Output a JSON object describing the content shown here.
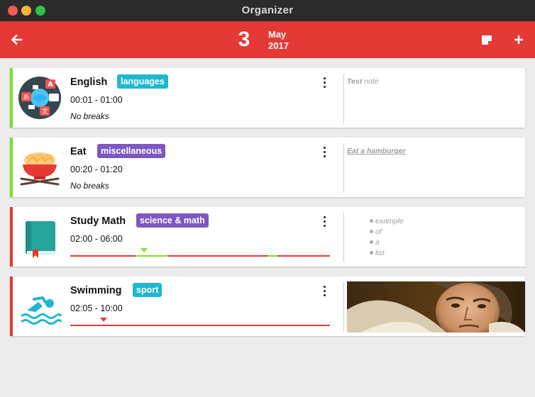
{
  "window": {
    "title": "Organizer"
  },
  "header": {
    "day": "3",
    "month": "May",
    "year": "2017",
    "back_icon": "arrow-left-icon",
    "note_icon": "note-icon",
    "add_icon": "plus-icon"
  },
  "colors": {
    "primary": "#e53935",
    "green": "#76e22a",
    "blue_tag": "#1fb6cf",
    "purple_tag": "#7e57c2"
  },
  "activities": [
    {
      "title": "English",
      "tag": "languages",
      "time": "00:01 - 01:00",
      "breaks": "No breaks",
      "note": "Test note",
      "note_label": "Test",
      "note_rest": " note",
      "status": "active",
      "icon": "translate-icon"
    },
    {
      "title": "Eat",
      "tag": "miscellaneous",
      "time": "00:20 - 01:20",
      "breaks": "No breaks",
      "note": "Eat a hamburger",
      "status": "active",
      "icon": "noodle-bowl-icon"
    },
    {
      "title": "Study Math",
      "tag": "science & math",
      "time": "02:00 - 06:00",
      "note_list": [
        "example",
        "of",
        "a",
        "list"
      ],
      "status": "inactive",
      "icon": "book-icon"
    },
    {
      "title": "Swimming",
      "tag": "sport",
      "time": "02:05 - 10:00",
      "status": "inactive",
      "icon": "swimmer-icon",
      "note_image": "portrait-image"
    }
  ]
}
